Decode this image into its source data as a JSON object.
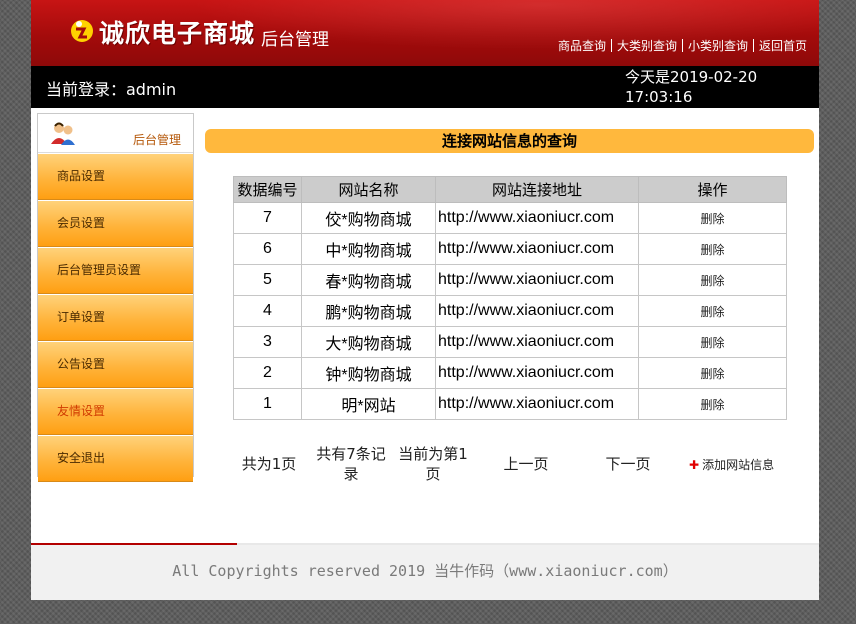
{
  "header": {
    "logo_text": "诚欣电子商城",
    "logo_subtitle": "后台管理",
    "nav": [
      "商品查询",
      "大类别查询",
      "小类别查询",
      "返回首页"
    ]
  },
  "infobar": {
    "login_text": "当前登录：admin",
    "datetime_text": "今天是2019-02-20 17:03:16"
  },
  "sidebar": {
    "title": "后台管理",
    "items": [
      "商品设置",
      "会员设置",
      "后台管理员设置",
      "订单设置",
      "公告设置",
      "友情设置",
      "安全退出"
    ],
    "active_index": 5
  },
  "main": {
    "section_title": "连接网站信息的查询",
    "table": {
      "headers": [
        "数据编号",
        "网站名称",
        "网站连接地址",
        "操作"
      ],
      "rows": [
        {
          "id": "7",
          "name": "佼*购物商城",
          "url": "http://www.xiaoniucr.com",
          "action": "删除"
        },
        {
          "id": "6",
          "name": "中*购物商城",
          "url": "http://www.xiaoniucr.com",
          "action": "删除"
        },
        {
          "id": "5",
          "name": "春*购物商城",
          "url": "http://www.xiaoniucr.com",
          "action": "删除"
        },
        {
          "id": "4",
          "name": "鹏*购物商城",
          "url": "http://www.xiaoniucr.com",
          "action": "删除"
        },
        {
          "id": "3",
          "name": "大*购物商城",
          "url": "http://www.xiaoniucr.com",
          "action": "删除"
        },
        {
          "id": "2",
          "name": "钟*购物商城",
          "url": "http://www.xiaoniucr.com",
          "action": "删除"
        },
        {
          "id": "1",
          "name": "明*网站",
          "url": "http://www.xiaoniucr.com",
          "action": "删除"
        }
      ]
    },
    "pager": {
      "total_pages": "共为1页",
      "total_records": "共有7条记录",
      "current_page": "当前为第1页",
      "prev": "上一页",
      "next": "下一页"
    },
    "add_site": "添加网站信息"
  },
  "footer": {
    "copyright": "All Copyrights reserved 2019 当牛作码（www.xiaoniucr.com）"
  },
  "colors": {
    "header_red": "#a30b0b",
    "sidebar_orange": "#ffb43c",
    "section_bar": "#ffb83d",
    "footer_accent": "#b30000"
  },
  "icons": {
    "logo": "logo-icon",
    "sidebar_avatar": "admin-users-icon",
    "add": "plus-icon"
  }
}
